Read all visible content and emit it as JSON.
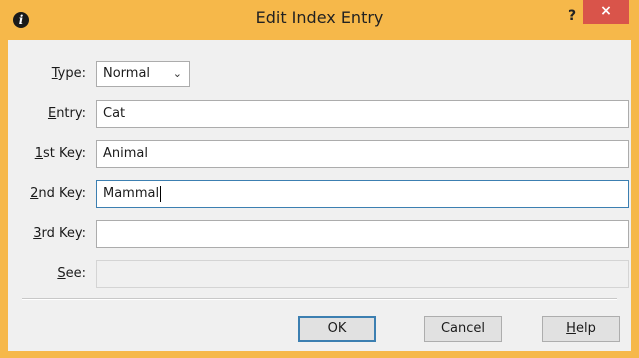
{
  "window": {
    "title": "Edit Index Entry",
    "help_glyph": "?",
    "close_glyph": "×",
    "app_icon_glyph": "i"
  },
  "type": {
    "label_first": "T",
    "label_rest": "ype:",
    "value": "Normal",
    "chevron": "⌄"
  },
  "entry": {
    "label_first": "E",
    "label_rest": "ntry:",
    "value": "Cat"
  },
  "key1": {
    "label_first": "1",
    "label_rest": "st Key:",
    "value": "Animal"
  },
  "key2": {
    "label_first": "2",
    "label_rest": "nd Key:",
    "value": "Mammal"
  },
  "key3": {
    "label_first": "3",
    "label_rest": "rd Key:",
    "value": ""
  },
  "see": {
    "label_first": "S",
    "label_rest": "ee:",
    "value": ""
  },
  "buttons": {
    "ok": "OK",
    "cancel": "Cancel",
    "help_first": "H",
    "help_rest": "elp"
  },
  "colors": {
    "titlebar": "#f6b84a",
    "close": "#d9544a",
    "focus_border": "#3c7fb1"
  }
}
